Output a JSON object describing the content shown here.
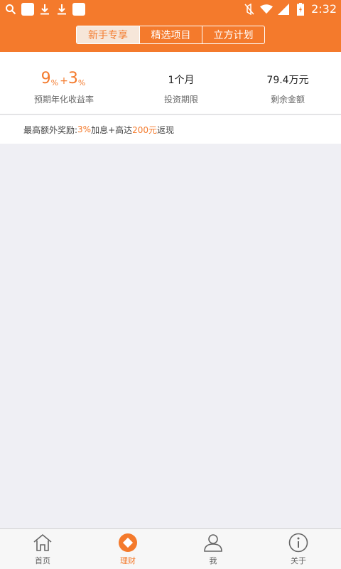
{
  "status_bar": {
    "time": "2:32",
    "icons": [
      "search-icon",
      "app-icon",
      "download-icon",
      "download-icon",
      "app-icon",
      "mute-icon",
      "wifi-icon",
      "signal-icon",
      "battery-icon"
    ]
  },
  "top_tabs": [
    {
      "label": "新手专享",
      "active": true
    },
    {
      "label": "精选项目",
      "active": false
    },
    {
      "label": "立方计划",
      "active": false
    }
  ],
  "summary": {
    "rate_base": "9",
    "rate_base_unit": "%",
    "rate_plus": "+",
    "rate_extra": "3",
    "rate_extra_unit": "%",
    "rate_label": "预期年化收益率",
    "period_value": "1个月",
    "period_label": "投资期限",
    "remaining_value": "79.4万元",
    "remaining_label": "剩余金额"
  },
  "bonus": {
    "prefix": "最高额外奖励:",
    "rate": "3%",
    "middle": "加息+高达",
    "amount": "200元",
    "suffix": "返现"
  },
  "bottom_nav": [
    {
      "label": "首页",
      "icon": "home-icon",
      "active": false
    },
    {
      "label": "理财",
      "icon": "finance-icon",
      "active": true
    },
    {
      "label": "我",
      "icon": "user-icon",
      "active": false
    },
    {
      "label": "关于",
      "icon": "info-icon",
      "active": false
    }
  ],
  "colors": {
    "accent": "#f47a2c",
    "background": "#efeff4"
  }
}
